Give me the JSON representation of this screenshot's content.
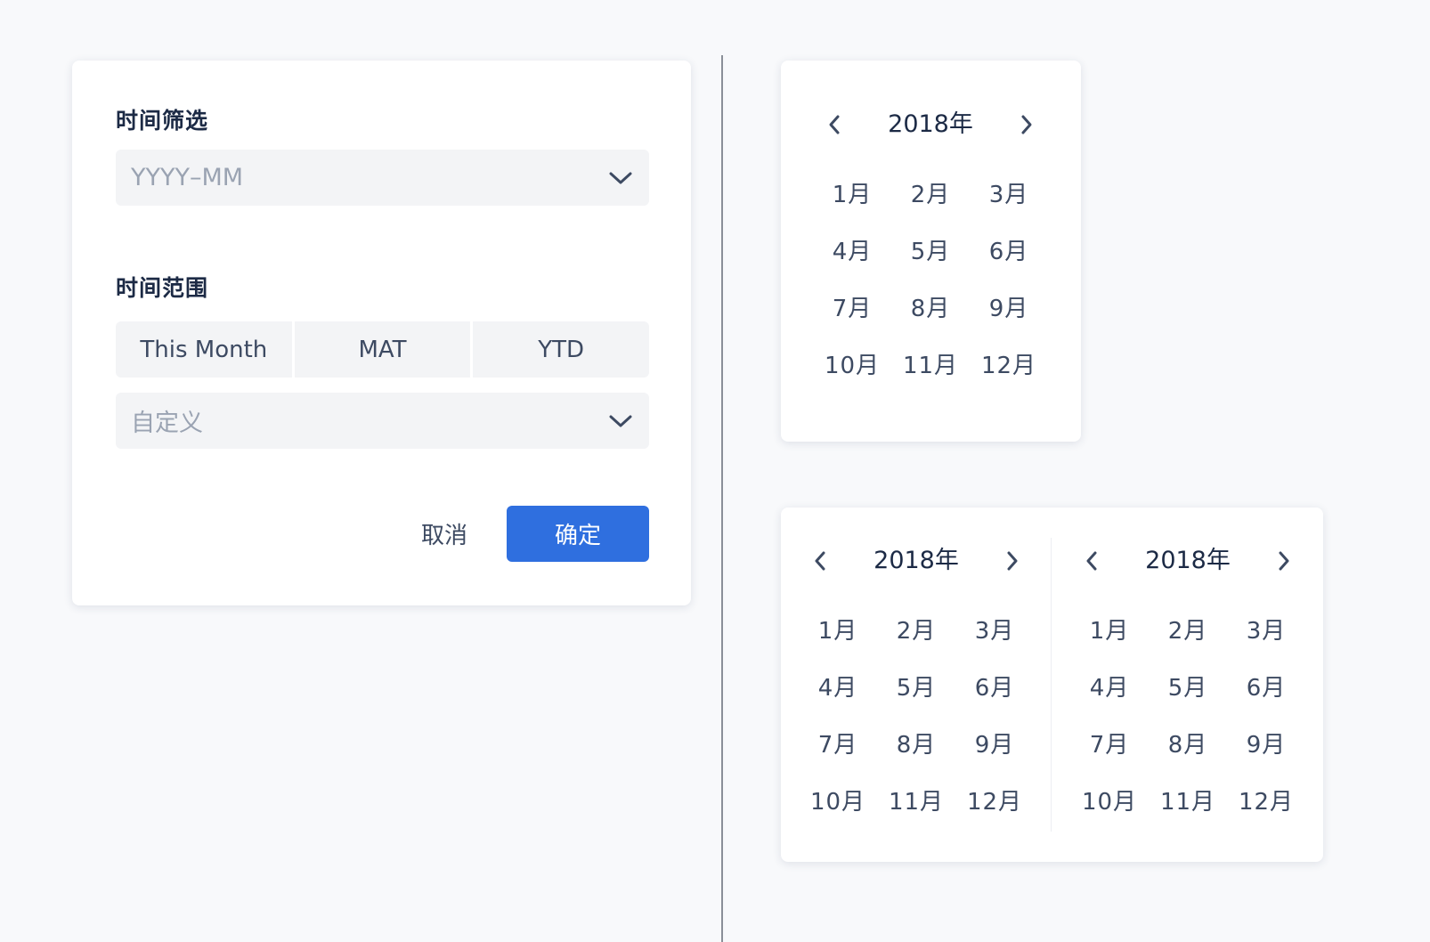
{
  "filter": {
    "filter_label": "时间筛选",
    "filter_placeholder": "YYYY–MM",
    "range_label": "时间范围",
    "range_options": [
      "This Month",
      "MAT",
      "YTD"
    ],
    "custom_placeholder": "自定义",
    "cancel_label": "取消",
    "confirm_label": "确定"
  },
  "picker_single": {
    "year": "2018年",
    "months": [
      "1月",
      "2月",
      "3月",
      "4月",
      "5月",
      "6月",
      "7月",
      "8月",
      "9月",
      "10月",
      "11月",
      "12月"
    ]
  },
  "picker_double": {
    "left": {
      "year": "2018年",
      "months": [
        "1月",
        "2月",
        "3月",
        "4月",
        "5月",
        "6月",
        "7月",
        "8月",
        "9月",
        "10月",
        "11月",
        "12月"
      ]
    },
    "right": {
      "year": "2018年",
      "months": [
        "1月",
        "2月",
        "3月",
        "4月",
        "5月",
        "6月",
        "7月",
        "8月",
        "9月",
        "10月",
        "11月",
        "12月"
      ]
    }
  },
  "colors": {
    "primary": "#2f6fdf",
    "background": "#f8f9fb",
    "text": "#3d4a62",
    "heading": "#1c2a45",
    "placeholder": "#9aa3b2",
    "field": "#f3f4f6"
  },
  "icons": {
    "dropdown": "chevron-down-icon",
    "prev": "chevron-left-icon",
    "next": "chevron-right-icon"
  }
}
